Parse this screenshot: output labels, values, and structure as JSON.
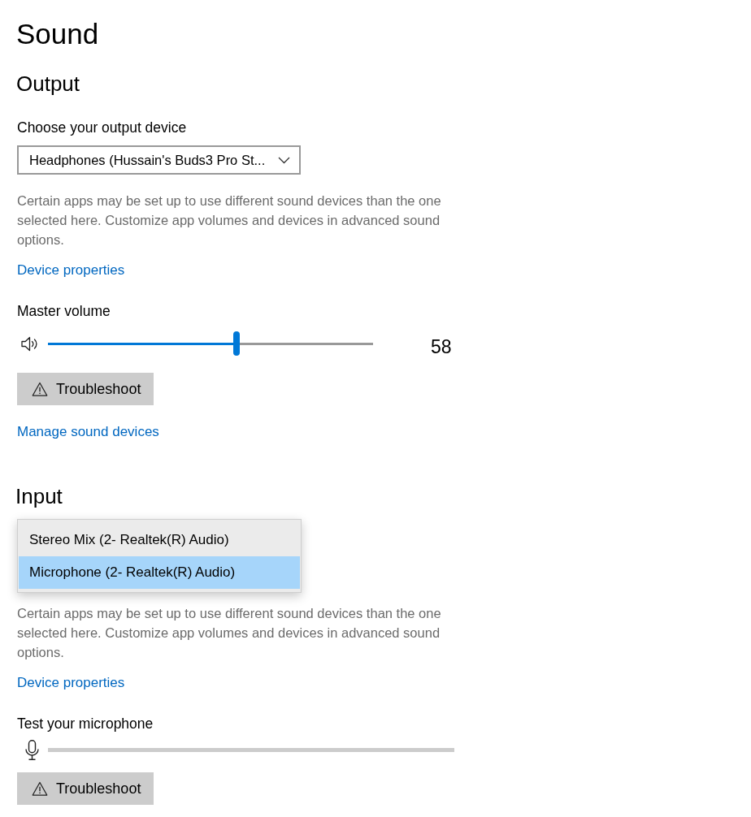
{
  "page": {
    "title": "Sound"
  },
  "output": {
    "heading": "Output",
    "device_label": "Choose your output device",
    "device_dropdown": {
      "value": "Headphones (Hussain's Buds3 Pro St..."
    },
    "description": "Certain apps may be set up to use different sound devices than the one selected here. Customize app volumes and devices in advanced sound options.",
    "device_properties_link": "Device properties",
    "master_volume": {
      "label": "Master volume",
      "level": 0.58,
      "reading": "58"
    },
    "troubleshoot_button": "Troubleshoot",
    "manage_link": "Manage sound devices"
  },
  "input": {
    "heading": "Input",
    "device_menu": [
      {
        "label": "Stereo Mix (2- Realtek(R) Audio)",
        "selected": false
      },
      {
        "label": "Microphone (2- Realtek(R) Audio)",
        "selected": true
      }
    ],
    "description": "Certain apps may be set up to use different sound devices than the one selected here. Customize app volumes and devices in advanced sound options.",
    "device_properties_link": "Device properties",
    "microphone_test": {
      "label": "Test your microphone",
      "level": 0
    },
    "troubleshoot_button": "Troubleshoot"
  }
}
